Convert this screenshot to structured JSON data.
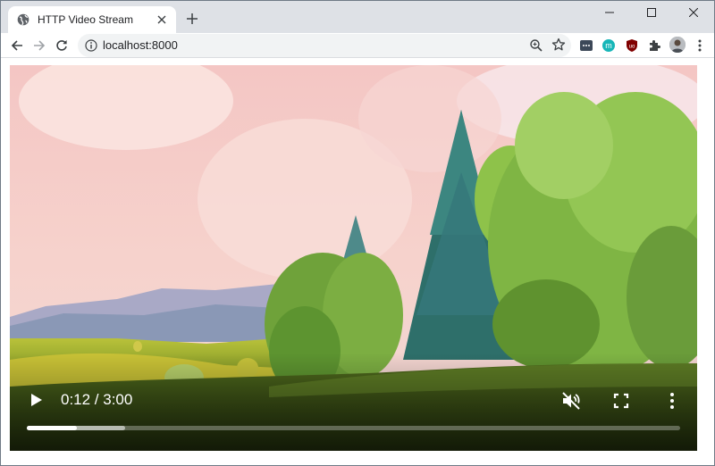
{
  "tab": {
    "title": "HTTP Video Stream",
    "favicon": "globe-icon",
    "close_icon": "close-icon"
  },
  "window_controls": [
    "minimize-icon",
    "maximize-icon",
    "close-icon"
  ],
  "toolbar": {
    "url": "localhost:8000",
    "nav_icons": [
      "back-arrow-icon",
      "forward-arrow-icon",
      "reload-icon"
    ],
    "omnibox_icons": [
      "info-icon",
      "zoom-icon",
      "star-icon"
    ],
    "extensions": [
      "dark-extension-icon",
      "teal-m-extension-icon",
      "ublock-origin-icon",
      "puzzle-extensions-icon"
    ],
    "menu_icon": "kebab-menu-icon"
  },
  "video": {
    "time_display": "0:12 / 3:00",
    "progress_played": 0.077,
    "progress_buffered": 0.15,
    "muted": true,
    "controls": [
      "play-icon",
      "muted-speaker-icon",
      "fullscreen-icon",
      "more-vert-icon"
    ]
  },
  "colors": {
    "tabstrip": "#dee1e6",
    "omnibox": "#f1f3f4",
    "control_fg": "#ffffff"
  }
}
